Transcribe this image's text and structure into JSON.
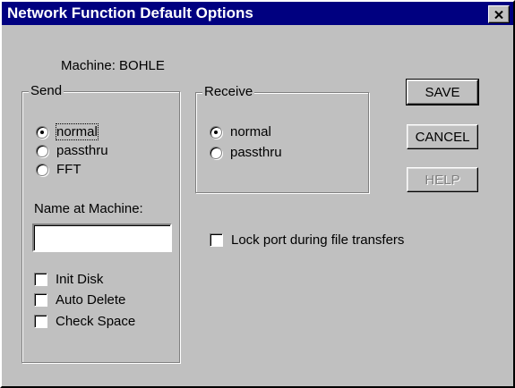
{
  "window": {
    "title": "Network Function Default Options"
  },
  "machine": {
    "label": "Machine:  BOHLE"
  },
  "send": {
    "legend": "Send",
    "options": [
      "normal",
      "passthru",
      "FFT"
    ],
    "selected": "normal",
    "name_at_machine_label": "Name at Machine:",
    "name_at_machine_value": "",
    "checkboxes": [
      "Init Disk",
      "Auto Delete",
      "Check Space"
    ]
  },
  "receive": {
    "legend": "Receive",
    "options": [
      "normal",
      "passthru"
    ],
    "selected": "normal"
  },
  "lock_port": {
    "label": "Lock port during file transfers"
  },
  "buttons": {
    "save": "SAVE",
    "cancel": "CANCEL",
    "help": "HELP"
  }
}
